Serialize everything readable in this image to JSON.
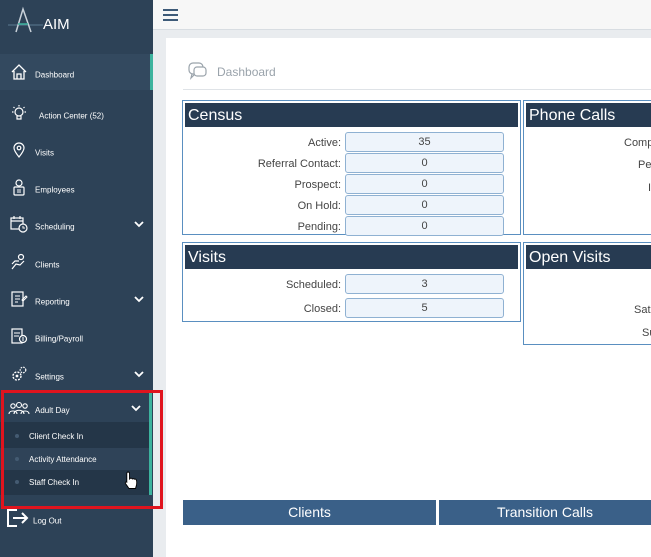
{
  "app": {
    "logo_text": "AIM"
  },
  "sidebar": {
    "items": [
      {
        "label": "Dashboard",
        "icon": "home-icon"
      },
      {
        "label": "Action Center (52)",
        "icon": "lightbulb-icon"
      },
      {
        "label": "Visits",
        "icon": "location-pin-icon"
      },
      {
        "label": "Employees",
        "icon": "employee-badge-icon"
      },
      {
        "label": "Scheduling",
        "icon": "calendar-clock-icon"
      },
      {
        "label": "Clients",
        "icon": "client-care-icon"
      },
      {
        "label": "Reporting",
        "icon": "report-icon"
      },
      {
        "label": "Billing/Payroll",
        "icon": "billing-icon"
      },
      {
        "label": "Settings",
        "icon": "gears-icon"
      },
      {
        "label": "Adult Day",
        "icon": "group-icon"
      }
    ],
    "adult_day_sub": [
      "Client Check In",
      "Activity Attendance",
      "Staff Check In"
    ],
    "logout": "Log Out"
  },
  "page": {
    "title": "Dashboard"
  },
  "census": {
    "title": "Census",
    "rows": [
      {
        "label": "Active:",
        "value": "35"
      },
      {
        "label": "Referral Contact:",
        "value": "0"
      },
      {
        "label": "Prospect:",
        "value": "0"
      },
      {
        "label": "On Hold:",
        "value": "0"
      },
      {
        "label": "Pending:",
        "value": "0"
      }
    ]
  },
  "phone_calls": {
    "title": "Phone Calls",
    "labels": [
      "Comp",
      "Pe",
      "I"
    ]
  },
  "visits": {
    "title": "Visits",
    "rows": [
      {
        "label": "Scheduled:",
        "value": "3"
      },
      {
        "label": "Closed:",
        "value": "5"
      }
    ]
  },
  "open_visits": {
    "title": "Open Visits",
    "labels": [
      "",
      "Sat",
      "Su"
    ]
  },
  "buttons": {
    "clients": "Clients",
    "transition_calls": "Transition Calls"
  },
  "colors": {
    "sidebar": "#2d4257",
    "header": "#273b52",
    "accent": "#3db39e",
    "highlight": "#e0141e",
    "button": "#3a6088"
  }
}
